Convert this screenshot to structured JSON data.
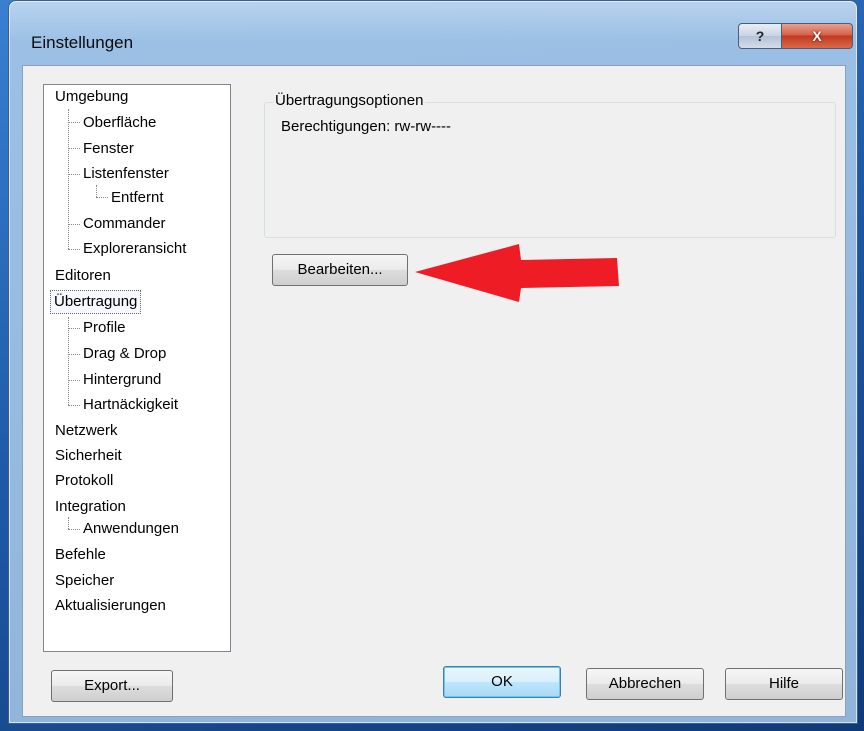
{
  "window": {
    "title": "Einstellungen",
    "help_glyph": "?",
    "close_glyph": "X"
  },
  "tree": {
    "items": [
      "Umgebung",
      "Oberfläche",
      "Fenster",
      "Listenfenster",
      "Entfernt",
      "Commander",
      "Exploreransicht",
      "Editoren",
      "Übertragung",
      "Profile",
      "Drag & Drop",
      "Hintergrund",
      "Hartnäckigkeit",
      "Netzwerk",
      "Sicherheit",
      "Protokoll",
      "Integration",
      "Anwendungen",
      "Befehle",
      "Speicher",
      "Aktualisierungen"
    ],
    "selected": "Übertragung"
  },
  "options": {
    "group_title": "Übertragungsoptionen",
    "permissions_text": "Berechtigungen: rw-rw----",
    "edit_button": "Bearbeiten..."
  },
  "footer": {
    "export_button": "Export...",
    "ok_button": "OK",
    "cancel_button": "Abbrechen",
    "help_button": "Hilfe"
  },
  "colors": {
    "annotation_arrow": "#ee1c24"
  }
}
